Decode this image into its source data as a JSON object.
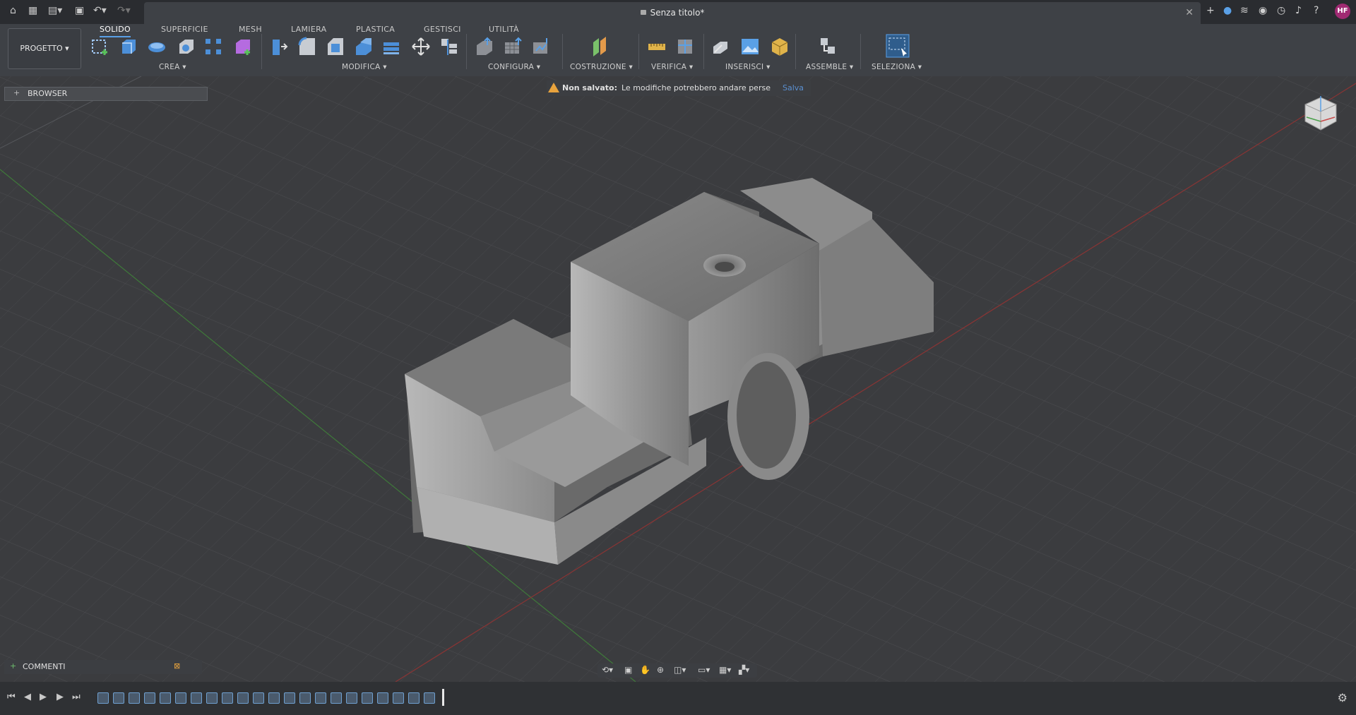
{
  "document": {
    "title": "Senza titolo*"
  },
  "user": {
    "initials": "HF"
  },
  "workspace": {
    "label": "PROGETTO ▾"
  },
  "ribbon_tabs": [
    "SOLIDO",
    "SUPERFICIE",
    "MESH",
    "LAMIERA",
    "PLASTICA",
    "GESTISCI",
    "UTILITÀ"
  ],
  "groups": [
    "CREA ▾",
    "MODIFICA ▾",
    "CONFIGURA ▾",
    "COSTRUZIONE ▾",
    "VERIFICA ▾",
    "INSERISCI ▾",
    "ASSEMBLE ▾",
    "SELEZIONA ▾"
  ],
  "browser": {
    "label": "BROWSER"
  },
  "warning": {
    "bold": "Non salvato:",
    "message": "Le modifiche potrebbero andare perse",
    "action": "Salva"
  },
  "comments": {
    "label": "COMMENTI"
  },
  "colors": {
    "accent": "#5aa0e6",
    "warning": "#e8a33d",
    "avatar": "#a02a72"
  }
}
